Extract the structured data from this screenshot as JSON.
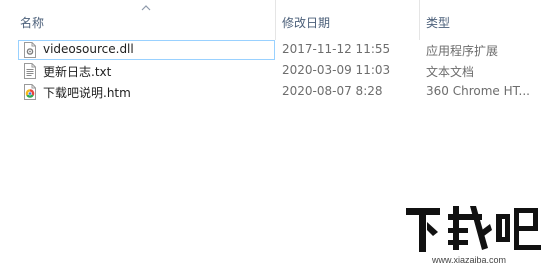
{
  "columns": {
    "name": "名称",
    "date": "修改日期",
    "type": "类型"
  },
  "sort": {
    "column": "name",
    "direction": "ascending",
    "icon": "caret-up-icon"
  },
  "files": [
    {
      "name": "videosource.dll",
      "date": "2017-11-12 11:55",
      "type": "应用程序扩展",
      "icon": "dll-file-icon",
      "focused": true
    },
    {
      "name": "更新日志.txt",
      "date": "2020-03-09 11:03",
      "type": "文本文档",
      "icon": "text-file-icon",
      "focused": false
    },
    {
      "name": "下载吧说明.htm",
      "date": "2020-08-07 8:28",
      "type": "360 Chrome HT...",
      "icon": "browser-file-icon",
      "focused": false
    }
  ],
  "watermark": {
    "logo_text": "下载吧",
    "url": "www.xiazaiba.com"
  },
  "colors": {
    "header_text": "#4c607a",
    "focus_border": "#99d1ff",
    "secondary_text": "#6d6d6d"
  }
}
